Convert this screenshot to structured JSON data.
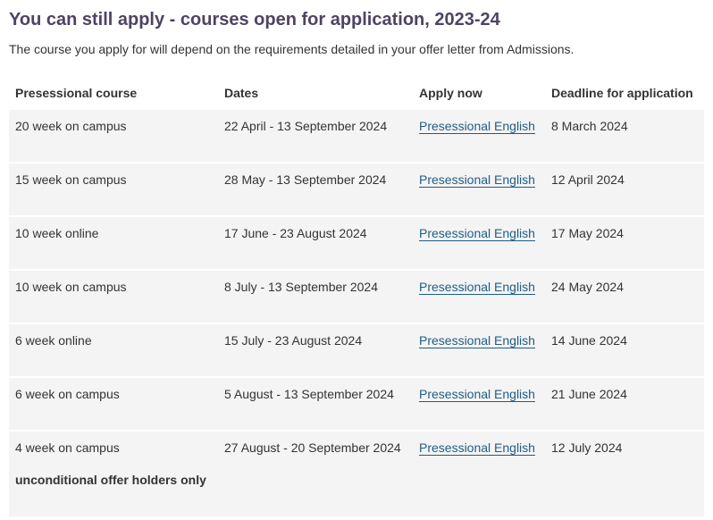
{
  "page": {
    "title": "You can still apply - courses open for application, 2023-24",
    "intro": "The course you apply for will depend on the requirements detailed in your offer letter from Admissions."
  },
  "table": {
    "headers": [
      "Presessional course",
      "Dates",
      "Apply now",
      "Deadline for application"
    ],
    "rows": [
      {
        "course": "20 week on campus",
        "dates": "22 April - 13 September 2024",
        "apply": "Presessional English",
        "deadline": "8 March 2024"
      },
      {
        "course": "15 week on campus",
        "dates": "28 May - 13 September 2024",
        "apply": "Presessional English",
        "deadline": "12 April 2024"
      },
      {
        "course": "10 week online",
        "dates": "17 June - 23 August 2024",
        "apply": "Presessional English",
        "deadline": "17 May 2024"
      },
      {
        "course": "10 week on campus",
        "dates": "8 July - 13 September 2024",
        "apply": "Presessional English",
        "deadline": "24 May 2024"
      },
      {
        "course": "6 week online",
        "dates": "15 July - 23 August 2024",
        "apply": "Presessional English",
        "deadline": "14 June 2024"
      },
      {
        "course": "6 week on campus",
        "dates": "5 August - 13 September 2024",
        "apply": "Presessional English",
        "deadline": "21 June 2024"
      },
      {
        "course": "4 week on campus",
        "note": "unconditional offer holders only",
        "dates": "27 August - 20 September 2024",
        "apply": "Presessional English",
        "deadline": "12 July 2024"
      }
    ]
  }
}
